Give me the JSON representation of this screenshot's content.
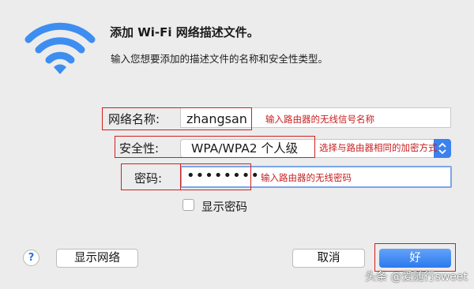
{
  "dialog": {
    "title": "添加 Wi-Fi 网络描述文件。",
    "subtitle": "输入您想要添加的描述文件的名称和安全性类型。"
  },
  "fields": {
    "network_name_label": "网络名称:",
    "network_name_value": "zhangsan",
    "security_label": "安全性:",
    "security_value": "WPA/WPA2 个人级",
    "password_label": "密码:",
    "password_masked": "••••••••"
  },
  "show_password": {
    "label": "显示密码",
    "checked": false
  },
  "annotations": {
    "network_name_note": "输入路由器的无线信号名称",
    "security_note": "选择与路由器相同的加密方式",
    "password_note": "输入路由器的无线密码"
  },
  "buttons": {
    "help": "?",
    "show_networks": "显示网络",
    "cancel": "取消",
    "ok": "好"
  },
  "watermark": "头条 @爱随行sweet",
  "colors": {
    "accent": "#2c79ee",
    "wifi_icon": "#3d8ef0",
    "annotation_red": "#c81e1e",
    "window_bg": "#ececec"
  },
  "icons": {
    "wifi": "wifi-icon",
    "stepper": "select-stepper-icon",
    "help": "help-icon"
  }
}
